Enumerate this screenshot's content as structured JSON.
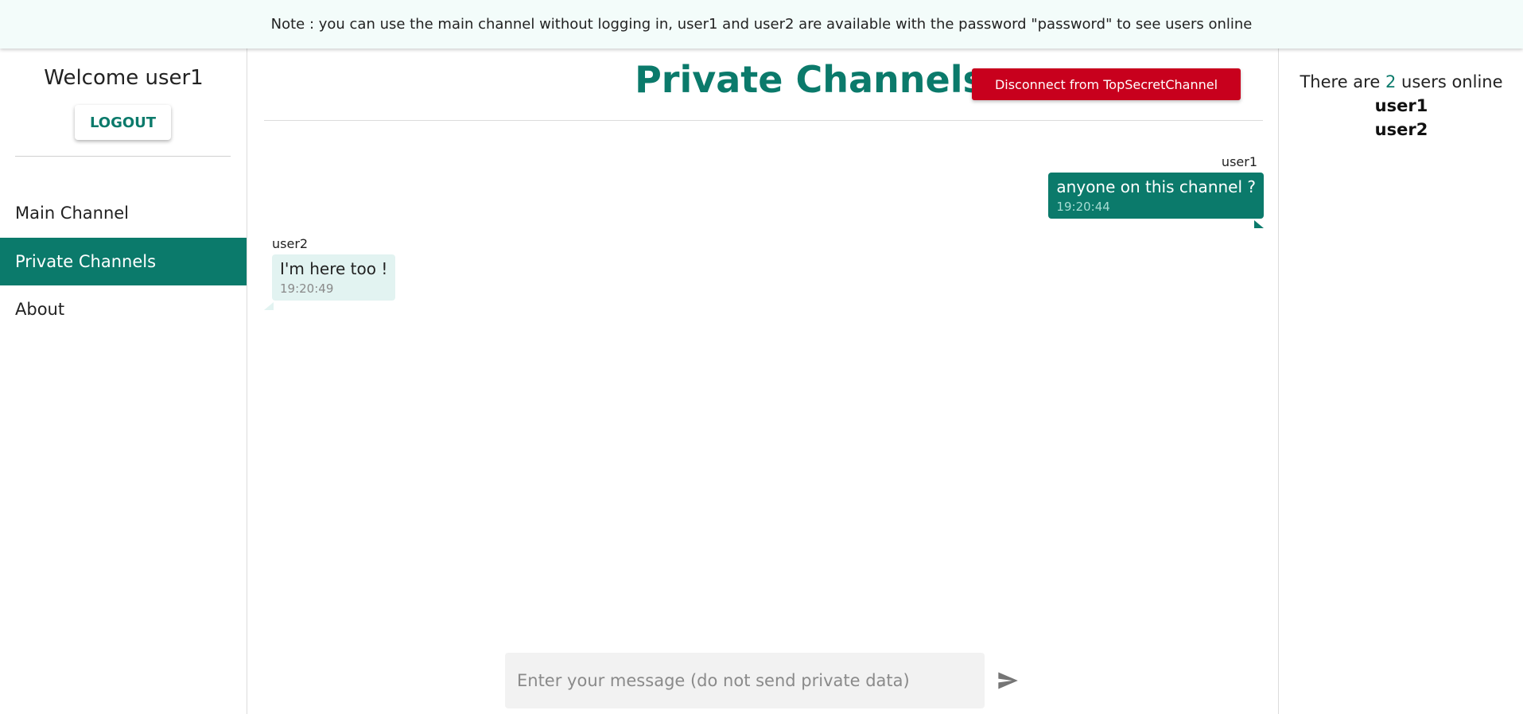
{
  "note": {
    "text": "Note : you can use the main channel without logging in, user1 and user2 are available with the password \"password\" to see users online"
  },
  "sidebar": {
    "welcome": "Welcome user1",
    "logout_label": "LOGOUT",
    "items": [
      {
        "label": "Main Channel",
        "active": false
      },
      {
        "label": "Private Channels",
        "active": true
      },
      {
        "label": "About",
        "active": false
      }
    ]
  },
  "main": {
    "title": "Private Channels",
    "disconnect_label": "Disconnect from TopSecretChannel",
    "messages": [
      {
        "user": "user1",
        "text": "anyone on this channel ?",
        "time": "19:20:44",
        "mine": true
      },
      {
        "user": "user2",
        "text": "I'm here too !",
        "time": "19:20:49",
        "mine": false
      }
    ],
    "composer": {
      "placeholder": "Enter your message (do not send private data)",
      "value": ""
    },
    "send_icon": "send-icon"
  },
  "online": {
    "prefix": "There are",
    "count": "2",
    "suffix": "users online",
    "users": [
      "user1",
      "user2"
    ]
  },
  "colors": {
    "accent": "#0b7a6b",
    "danger": "#c8001d",
    "note_bg": "#f3fcfa",
    "bubble_theirs": "#e2f3f1"
  }
}
